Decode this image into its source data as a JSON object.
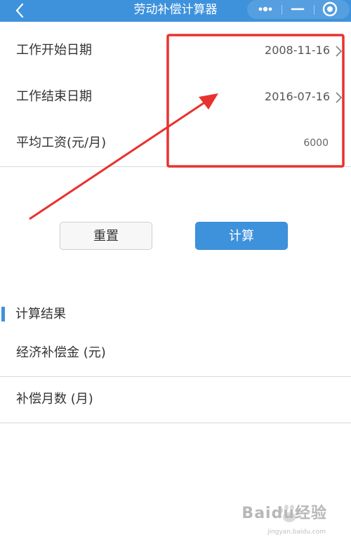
{
  "titlebar": {
    "title": "劳动补偿计算器",
    "color": "#3e92dc",
    "icons": [
      "back-icon",
      "more-icon",
      "minimize-icon",
      "close-icon"
    ]
  },
  "form": {
    "rows": [
      {
        "label": "工作开始日期",
        "value": "2008-11-16"
      },
      {
        "label": "工作结束日期",
        "value": "2016-07-16"
      },
      {
        "label": "平均工资(元/月)",
        "value": "6000"
      }
    ]
  },
  "buttons": {
    "reset_label": "重置",
    "calc_label": "计算"
  },
  "results": {
    "section_title": "计算结果",
    "rows": [
      {
        "label": "经济补偿金 (元)"
      },
      {
        "label": "补偿月数 (月)"
      }
    ]
  },
  "annotation": {
    "highlight_color": "#e8322e"
  },
  "watermark": {
    "brand": "Baidu经验",
    "url": "jingyan.baidu.com"
  }
}
